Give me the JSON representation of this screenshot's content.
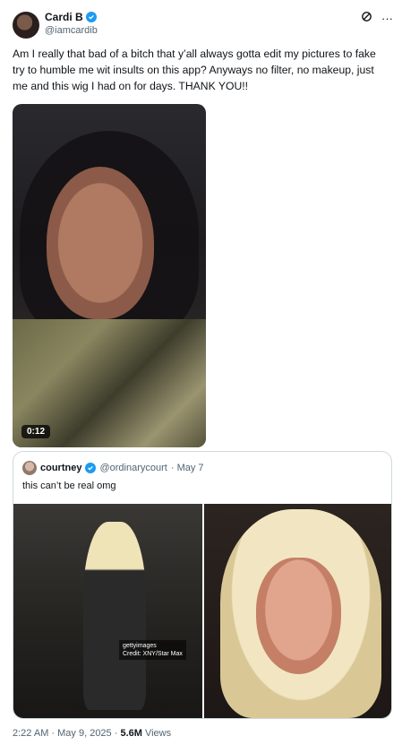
{
  "author": {
    "name": "Cardi B",
    "handle": "@iamcardib"
  },
  "header": {
    "grok_icon": "grok-icon",
    "more_icon": "more-icon"
  },
  "tweet": {
    "text": "Am I really that bad of a bitch that y’all always gotta edit my pictures to fake try to humble me wit insults on this app? Anyways no filter, no makeup,  just me and this wig I had on for days. THANK YOU!!",
    "video_duration": "0:12"
  },
  "quote": {
    "name": "courtney",
    "handle": "@ordinarycourt",
    "date": "· May 7",
    "text": "this can’t be real omg",
    "watermark_line1": "gettyimages",
    "watermark_line2": "Credit: XNY/Star Max"
  },
  "footer": {
    "timestamp": "2:22 AM · May 9, 2025 · ",
    "views_count": "5.6M",
    "views_label": " Views"
  },
  "colors": {
    "accent": "#1d9bf0",
    "secondary_text": "#536471",
    "border": "#cfd9de"
  }
}
